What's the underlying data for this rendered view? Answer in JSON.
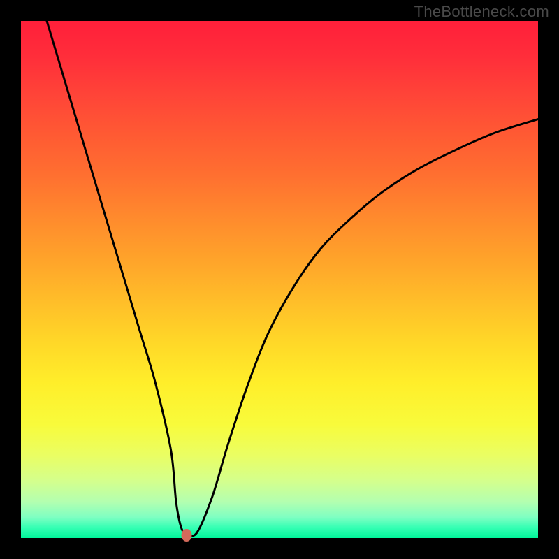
{
  "attribution": "TheBottleneck.com",
  "chart_data": {
    "type": "line",
    "title": "",
    "xlabel": "",
    "ylabel": "",
    "xlim": [
      0,
      100
    ],
    "ylim": [
      0,
      100
    ],
    "series": [
      {
        "name": "curve",
        "x": [
          5,
          8,
          11,
          14,
          17,
          20,
          23,
          26,
          29,
          30,
          31,
          32,
          34,
          37,
          40,
          44,
          48,
          53,
          58,
          64,
          70,
          77,
          85,
          92,
          100
        ],
        "y": [
          100,
          90,
          80,
          70,
          60,
          50,
          40,
          30,
          17,
          7,
          2,
          1,
          1,
          8,
          18,
          30,
          40,
          49,
          56,
          62,
          67,
          71.5,
          75.5,
          78.5,
          81
        ]
      }
    ],
    "marker": {
      "x": 32,
      "y": 0.5
    },
    "background_gradient": {
      "top": "#ff1f3a",
      "mid": "#ffee2a",
      "bottom": "#00f59a"
    }
  }
}
